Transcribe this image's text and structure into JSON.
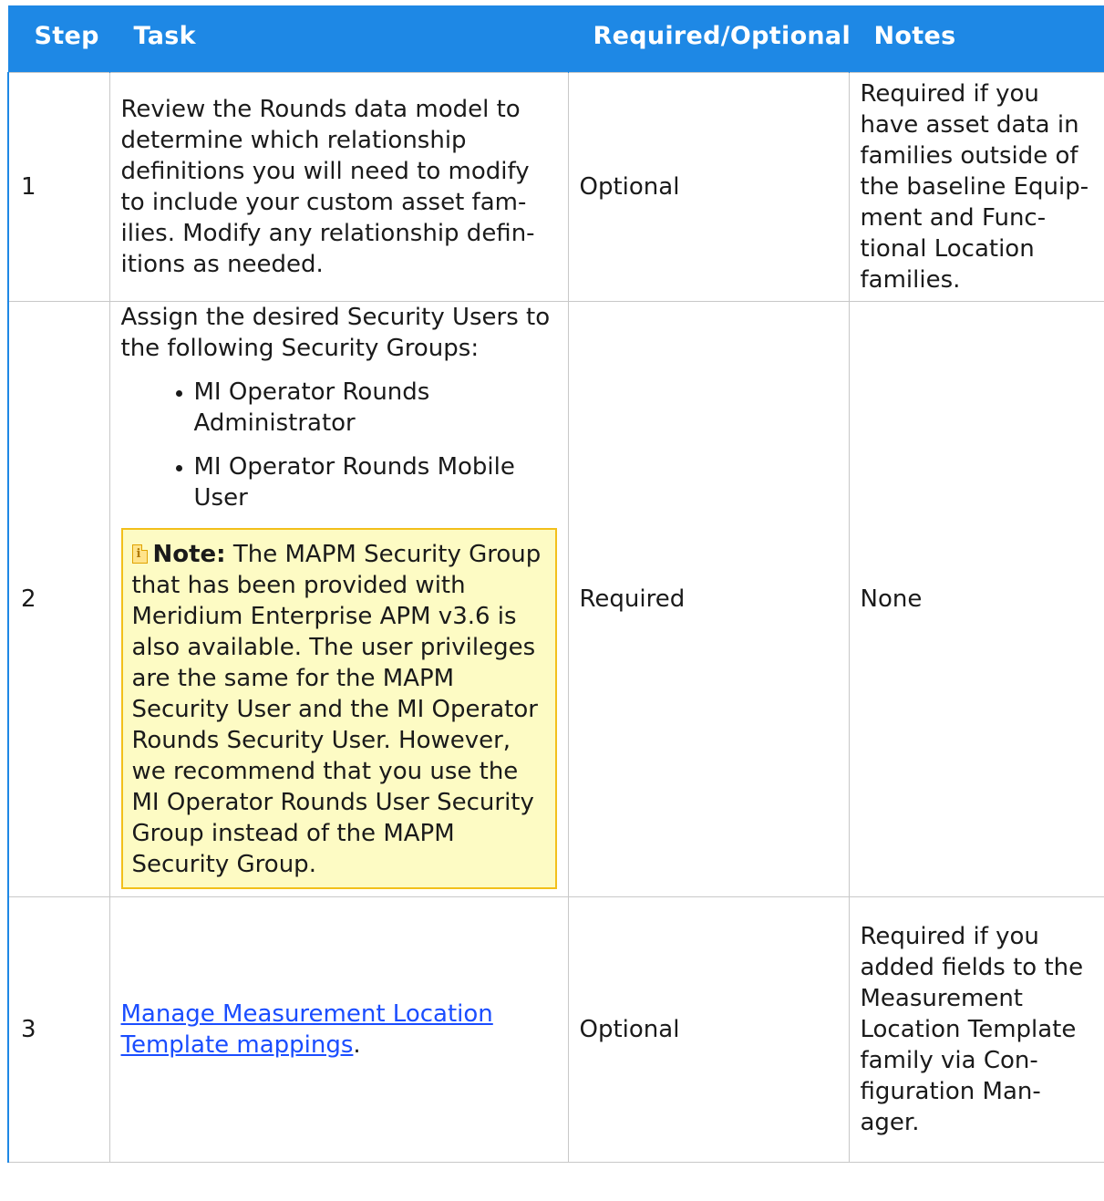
{
  "header": {
    "step": "Step",
    "task": "Task",
    "required": "Required/Optional",
    "notes": "Notes"
  },
  "rows": [
    {
      "step": "1",
      "task": "Review the Rounds data model to determine which relationship definitions you will need to modify to include your custom asset fam-ilies. Modify any relationship defin-itions as needed.",
      "required": "Optional",
      "notes": "Required if you have asset data in families outside of the baseline Equip-ment and Func-tional Location families."
    },
    {
      "step": "2",
      "task_intro": "Assign the desired Security Users to the following Security Groups:",
      "groups": [
        "MI Operator Rounds Administrator",
        "MI Operator Rounds Mobile User"
      ],
      "note_label": "Note:",
      "note_text": "The MAPM Security Group that has been provided with Meridium Enterprise APM v3.6 is also available. The user privileges are the same for the MAPM Security User and the MI Operator Rounds Security User. However, we recommend that you use the MI Operator Rounds User Security Group instead of the MAPM Security Group.",
      "required": "Required",
      "notes": "None"
    },
    {
      "step": "3",
      "task_link": "Manage Measurement Location Template mappings",
      "task_suffix": ".",
      "required": "Optional",
      "notes": "Required if you added fields to the Measurement Location Template family via Con-figuration Man-ager."
    }
  ],
  "colors": {
    "header_bg": "#1e88e5",
    "note_bg": "#fdfbc4",
    "note_border": "#f2c01b",
    "link": "#1a4dff"
  },
  "icons": {
    "note": "note-icon"
  }
}
